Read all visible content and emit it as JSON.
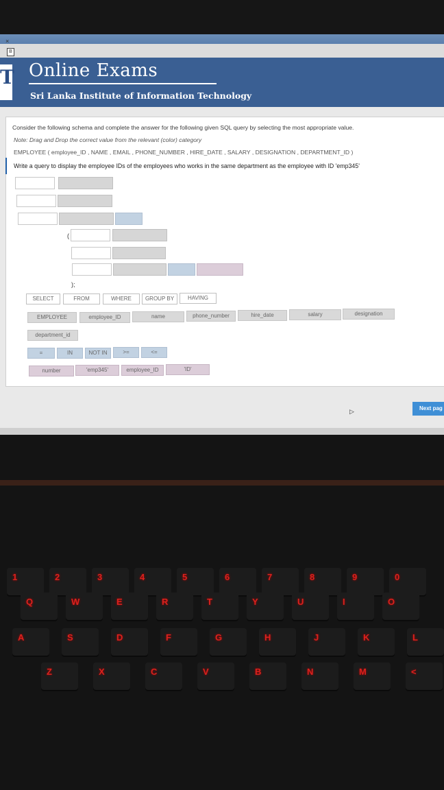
{
  "header": {
    "logo_letter": "T",
    "title": "Online Exams",
    "subtitle": "Sri Lanka Institute of Information Technology"
  },
  "browser": {
    "tab_close": "×",
    "tab_icon": "B"
  },
  "question": {
    "instruction": "Consider the following schema and complete the answer for the following given SQL query by selecting the most appropriate value.",
    "note": "Note: Drag and Drop the correct value from the relevant (color) category",
    "schema": "EMPLOYEE ( employee_ID , NAME , EMAIL , PHONE_NUMBER , HIRE_DATE , SALARY , DESIGNATION , DEPARTMENT_ID )",
    "task": "Write a query to display the employee IDs of the employees who works in the same department as the employee with ID 'emp345'"
  },
  "answer": {
    "open_paren": "(",
    "close_paren": ");"
  },
  "tokens": {
    "keywords": [
      "SELECT",
      "FROM",
      "WHERE",
      "GROUP BY",
      "HAVING"
    ],
    "columns": [
      "EMPLOYEE",
      "employee_ID",
      "name",
      "phone_number",
      "hire_date",
      "salary",
      "designation",
      "department_id"
    ],
    "operators": [
      "=",
      "IN",
      "NOT IN",
      ">=",
      "<="
    ],
    "values": [
      "number",
      "'emp345'",
      "employee_ID",
      "'ID'"
    ]
  },
  "navigation": {
    "next_label": "Next pag"
  },
  "keyboard": {
    "number_row": [
      "1",
      "2",
      "3",
      "4",
      "5",
      "6",
      "7",
      "8",
      "9",
      "0"
    ],
    "top_row": [
      "Q",
      "W",
      "E",
      "R",
      "T",
      "Y",
      "U",
      "I",
      "O"
    ],
    "home_row": [
      "A",
      "S",
      "D",
      "F",
      "G",
      "H",
      "J",
      "K",
      "L"
    ],
    "bottom_row": [
      "Z",
      "X",
      "C",
      "V",
      "B",
      "N",
      "M",
      "<"
    ]
  }
}
